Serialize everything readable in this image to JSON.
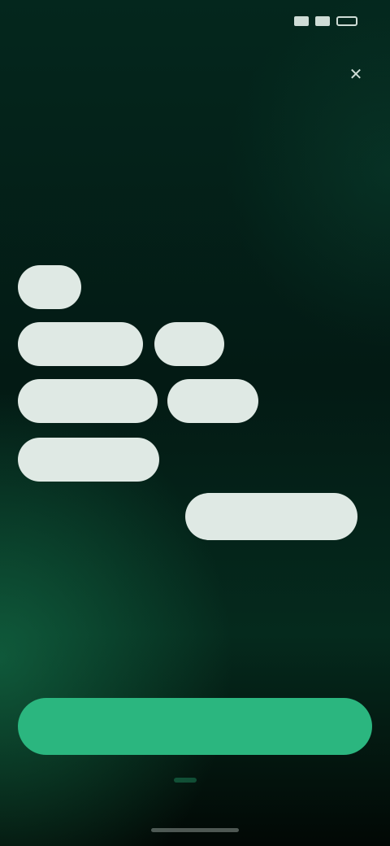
{
  "status_bar": {
    "time": ""
  },
  "header": {
    "title": "",
    "subtitle": ""
  },
  "options": [
    {
      "label": "",
      "selected": true
    },
    {
      "label": "",
      "selected": false
    },
    {
      "label": "",
      "selected": false
    },
    {
      "label": "",
      "selected": true
    },
    {
      "label": "",
      "selected": true
    },
    {
      "label": "",
      "selected": false
    },
    {
      "label": "",
      "selected": true
    },
    {
      "label": "",
      "selected": true
    },
    {
      "label": "",
      "selected": true
    },
    {
      "label": "",
      "selected": false
    },
    {
      "label": "",
      "selected": false
    },
    {
      "label": "",
      "selected": true
    },
    {
      "label": "",
      "selected": false
    }
  ],
  "footer": {
    "continue_label": ""
  },
  "colors": {
    "accent": "#2bb67f",
    "chip_selected": "#dfe9e4",
    "background": "#031a14"
  }
}
